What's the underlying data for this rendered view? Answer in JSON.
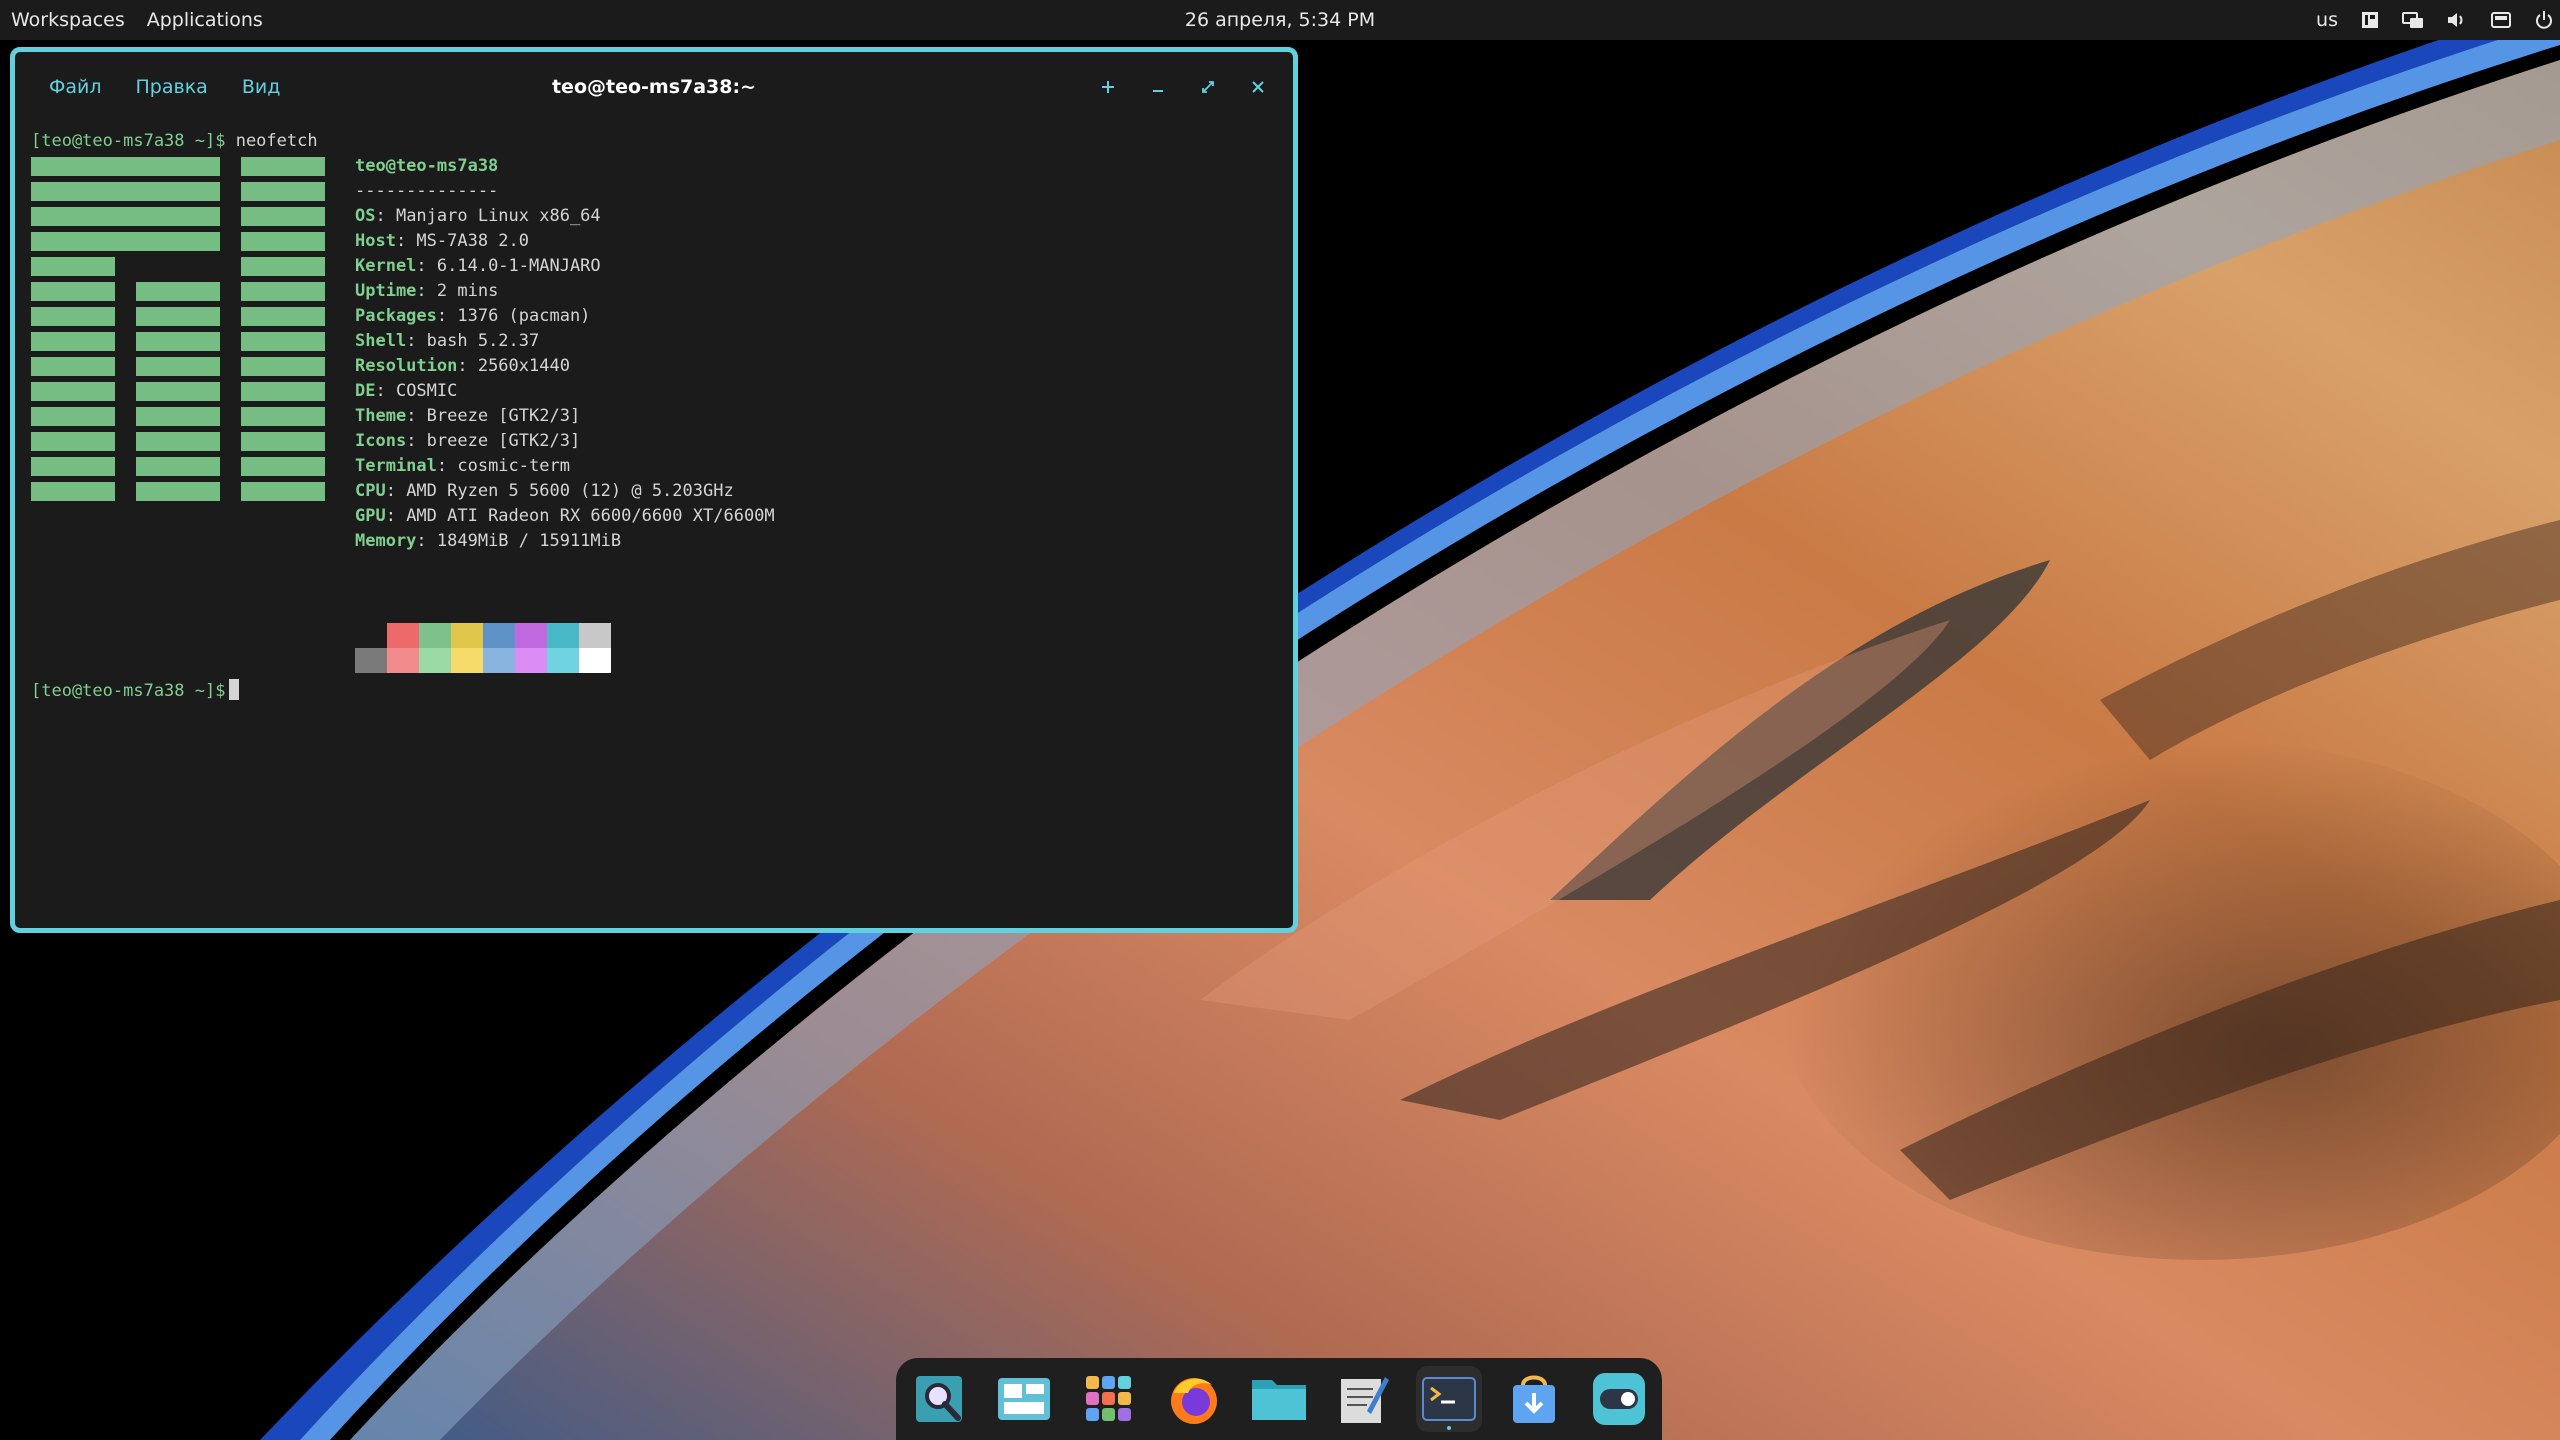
{
  "top_panel": {
    "workspaces": "Workspaces",
    "applications": "Applications",
    "clock": "26 апреля, 5:34 PM",
    "keyboard_layout": "us",
    "tray_icons": [
      "notifications-icon",
      "network-icon",
      "volume-icon",
      "battery-icon",
      "power-icon"
    ]
  },
  "terminal": {
    "title": "teo@teo-ms7a38:~",
    "menu": [
      "Файл",
      "Правка",
      "Вид"
    ],
    "controls": [
      "new-tab-icon",
      "minimize-icon",
      "maximize-icon",
      "close-icon"
    ],
    "prompt1": "[teo@teo-ms7a38 ~]$",
    "command1": " neofetch",
    "prompt2": "[teo@teo-ms7a38 ~]$",
    "neofetch": {
      "user_host": "teo@teo-ms7a38",
      "separator": "--------------",
      "lines": [
        {
          "key": "OS",
          "value": ": Manjaro Linux x86_64"
        },
        {
          "key": "Host",
          "value": ": MS-7A38 2.0"
        },
        {
          "key": "Kernel",
          "value": ": 6.14.0-1-MANJARO"
        },
        {
          "key": "Uptime",
          "value": ": 2 mins"
        },
        {
          "key": "Packages",
          "value": ": 1376 (pacman)"
        },
        {
          "key": "Shell",
          "value": ": bash 5.2.37"
        },
        {
          "key": "Resolution",
          "value": ": 2560x1440"
        },
        {
          "key": "DE",
          "value": ": COSMIC"
        },
        {
          "key": "Theme",
          "value": ": Breeze [GTK2/3]"
        },
        {
          "key": "Icons",
          "value": ": breeze [GTK2/3]"
        },
        {
          "key": "Terminal",
          "value": ": cosmic-term"
        },
        {
          "key": "CPU",
          "value": ": AMD Ryzen 5 5600 (12) @ 5.203GHz"
        },
        {
          "key": "GPU",
          "value": ": AMD ATI Radeon RX 6600/6600 XT/6600M"
        },
        {
          "key": "Memory",
          "value": ": 1849MiB / 15911MiB"
        }
      ],
      "palette_top": [
        "#1b1b1b",
        "#ed6a6a",
        "#7fc18a",
        "#e0c64a",
        "#5f93c7",
        "#c16ae0",
        "#4ab9c7",
        "#c8c8c8"
      ],
      "palette_bottom": [
        "#7a7a7a",
        "#f28b8b",
        "#9bd9a5",
        "#f5dc6a",
        "#8ab4e0",
        "#dc8cf5",
        "#6fd3e0",
        "#ffffff"
      ]
    }
  },
  "dock": {
    "apps": [
      {
        "name": "search-app-icon",
        "active": false
      },
      {
        "name": "workspaces-app-icon",
        "active": false
      },
      {
        "name": "app-library-icon",
        "active": false
      },
      {
        "name": "firefox-icon",
        "active": false
      },
      {
        "name": "files-icon",
        "active": false
      },
      {
        "name": "text-editor-icon",
        "active": false
      },
      {
        "name": "terminal-icon",
        "active": true
      },
      {
        "name": "store-icon",
        "active": false
      },
      {
        "name": "settings-icon",
        "active": false
      }
    ]
  }
}
